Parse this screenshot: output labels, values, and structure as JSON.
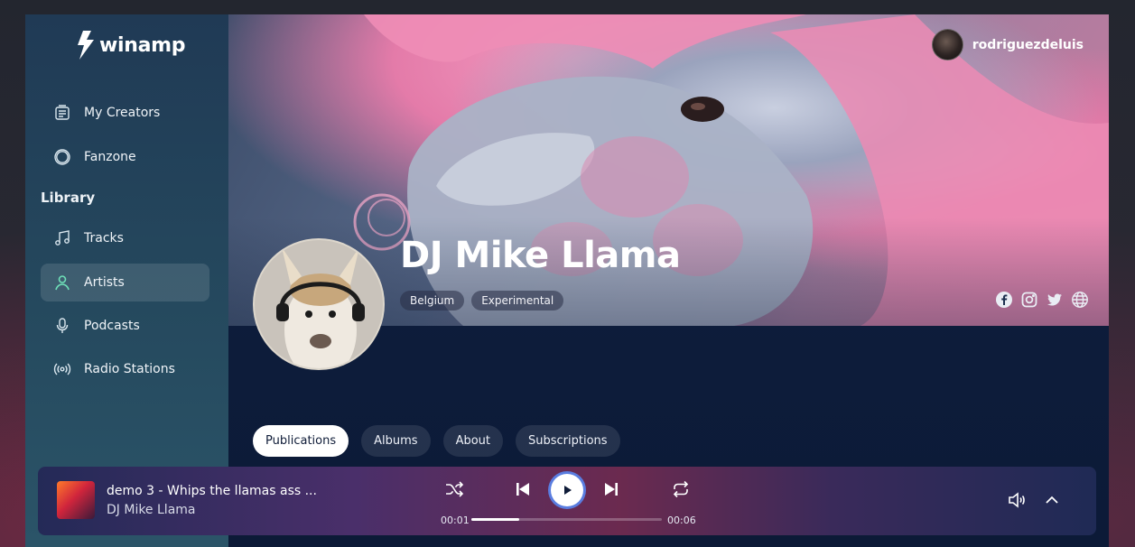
{
  "app": {
    "logo_text": "winamp"
  },
  "sidebar": {
    "items_top": [
      {
        "label": "My Creators",
        "icon": "creators-icon"
      },
      {
        "label": "Fanzone",
        "icon": "fanzone-icon"
      }
    ],
    "library_label": "Library",
    "library_items": [
      {
        "label": "Tracks",
        "icon": "music-note-icon"
      },
      {
        "label": "Artists",
        "icon": "person-icon",
        "active": true
      },
      {
        "label": "Podcasts",
        "icon": "microphone-icon"
      },
      {
        "label": "Radio Stations",
        "icon": "radio-icon"
      }
    ]
  },
  "header": {
    "username": "rodriguezdeluis"
  },
  "artist": {
    "name": "DJ Mike Llama",
    "tags": [
      "Belgium",
      "Experimental"
    ],
    "socials": [
      "facebook-icon",
      "instagram-icon",
      "twitter-icon",
      "globe-icon"
    ]
  },
  "tabs": [
    {
      "label": "Publications",
      "active": true
    },
    {
      "label": "Albums"
    },
    {
      "label": "About"
    },
    {
      "label": "Subscriptions"
    }
  ],
  "player": {
    "track_title": "demo 3 - Whips the llamas ass ...",
    "track_artist": "DJ Mike Llama",
    "time_elapsed": "00:01",
    "time_total": "00:06",
    "progress": 0.25
  },
  "colors": {
    "sidebar_bg": "#25495e",
    "main_bg": "#0d1c36",
    "active_tab_bg": "#ffffff",
    "accent_ring": "#5a7de0"
  }
}
